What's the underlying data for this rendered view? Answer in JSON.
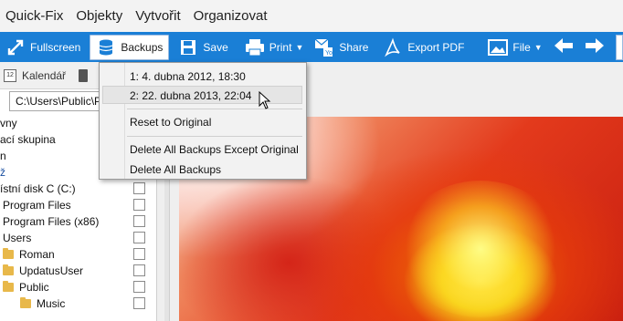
{
  "menu": [
    "Quick-Fix",
    "Objekty",
    "Vytvořit",
    "Organizovat"
  ],
  "toolbar": {
    "fullscreen": "Fullscreen",
    "backups": "Backups",
    "save": "Save",
    "print": "Print",
    "share": "Share",
    "export_pdf": "Export PDF",
    "file": "File"
  },
  "left_panel": {
    "calendar_tab": "Kalendář",
    "path": "C:\\Users\\Public\\P",
    "tree": [
      {
        "label": "vny",
        "checkbox": false
      },
      {
        "label": "ací skupina",
        "checkbox": false
      },
      {
        "label": "n",
        "checkbox": false
      },
      {
        "label": "ž",
        "checkbox": false
      },
      {
        "label": "ístní disk C (C:)",
        "checkbox": true
      },
      {
        "label": "Program Files",
        "checkbox": true
      },
      {
        "label": "Program Files (x86)",
        "checkbox": true
      },
      {
        "label": "Users",
        "checkbox": true
      },
      {
        "label": "Roman",
        "checkbox": true,
        "folder": true
      },
      {
        "label": "UpdatusUser",
        "checkbox": true,
        "folder": true
      },
      {
        "label": "Public",
        "checkbox": true,
        "folder": true
      },
      {
        "label": "Music",
        "checkbox": true,
        "folder": true
      }
    ]
  },
  "backups_menu": {
    "items": [
      "1: 4. dubna 2012, 18:30",
      "2: 22. dubna 2013, 22:04",
      "Reset to Original",
      "Delete All Backups Except Original",
      "Delete All Backups"
    ],
    "highlighted_index": 1
  },
  "colors": {
    "toolbar_blue": "#1a7fd6",
    "menubar_bg": "#f3f3f3"
  },
  "icons": [
    "fullscreen-icon",
    "database-icon",
    "floppy-icon",
    "printer-icon",
    "share-icon",
    "pdf-icon",
    "image-icon",
    "arrow-left-icon",
    "arrow-right-icon"
  ]
}
